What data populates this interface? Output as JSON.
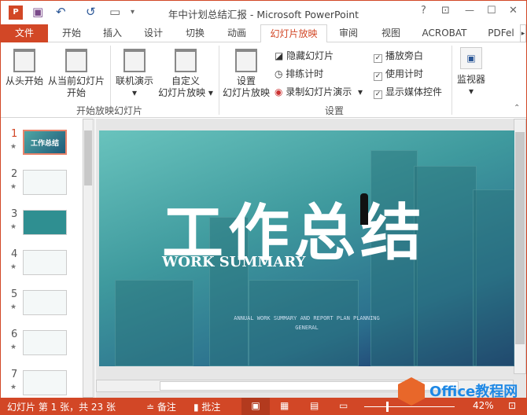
{
  "window": {
    "title": "年中计划总结汇报 - Microsoft PowerPoint",
    "help": "?",
    "restore_ribbon": "⊡",
    "minimize": "—",
    "maximize": "☐",
    "close": "✕"
  },
  "quick_access": {
    "undo": "↶",
    "redo": "↺"
  },
  "tabs": [
    {
      "label": "文件"
    },
    {
      "label": "开始"
    },
    {
      "label": "插入"
    },
    {
      "label": "设计"
    },
    {
      "label": "切换"
    },
    {
      "label": "动画"
    },
    {
      "label": "幻灯片放映"
    },
    {
      "label": "审阅"
    },
    {
      "label": "视图"
    },
    {
      "label": "ACROBAT"
    },
    {
      "label": "PDFel"
    }
  ],
  "ribbon": {
    "from_beginning": "从头开始",
    "from_current": "从当前幻灯片",
    "from_current2": "开始",
    "online": "联机演示",
    "custom": "自定义",
    "custom2": "幻灯片放映",
    "group1": "开始放映幻灯片",
    "setup": "设置",
    "setup2": "幻灯片放映",
    "hide": "隐藏幻灯片",
    "rehearse": "排练计时",
    "record": "录制幻灯片演示",
    "narration": "播放旁白",
    "use_timings": "使用计时",
    "media_controls": "显示媒体控件",
    "group2": "设置",
    "monitor": "监视器"
  },
  "slides": [
    {
      "n": "1"
    },
    {
      "n": "2"
    },
    {
      "n": "3"
    },
    {
      "n": "4"
    },
    {
      "n": "5"
    },
    {
      "n": "6"
    },
    {
      "n": "7"
    }
  ],
  "slide": {
    "title": "工作总结",
    "subtitle": "WORK SUMMARY",
    "line1": "ANNUAL WORK SUMMARY AND REPORT PLAN PLANNING",
    "line2": "GENERAL"
  },
  "status": {
    "slide_info": "幻灯片 第 1 张，共 23 张",
    "notes": "备注",
    "comments": "批注",
    "zoom": "42%"
  },
  "watermark": "Office教程网"
}
